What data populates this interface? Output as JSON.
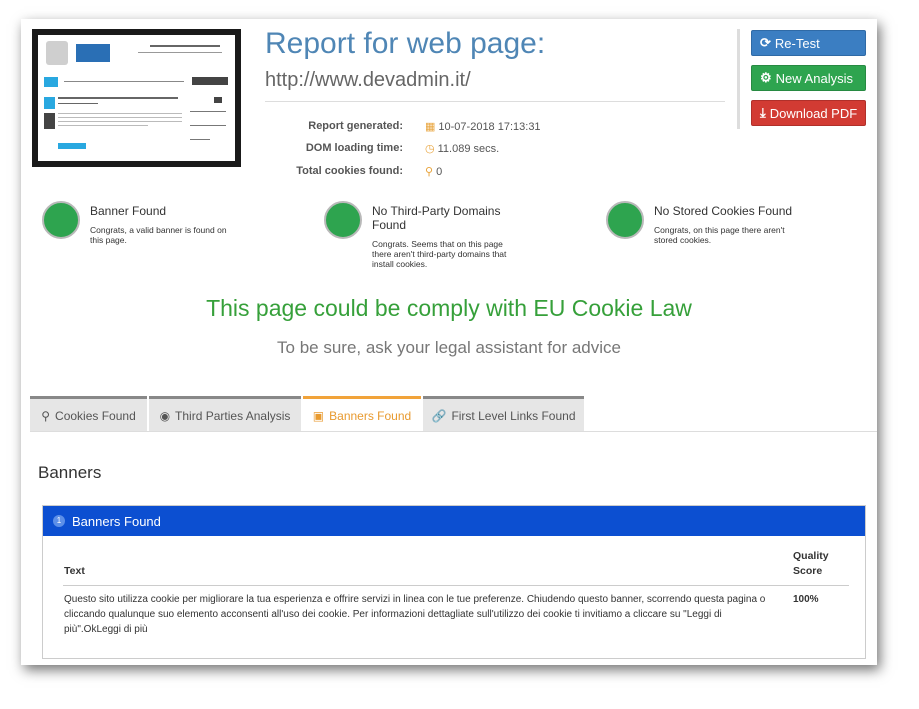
{
  "header": {
    "title": "Report for web page:",
    "url": "http://www.devadmin.it/"
  },
  "meta": {
    "generated_label": "Report generated:",
    "generated_value": "10-07-2018 17:13:31",
    "dom_label": "DOM loading time:",
    "dom_value": "11.089 secs.",
    "cookies_label": "Total cookies found:",
    "cookies_value": "0"
  },
  "buttons": {
    "retest": "Re-Test",
    "new_analysis": "New Analysis",
    "download_pdf": "Download PDF"
  },
  "status": [
    {
      "title": "Banner Found",
      "desc": "Congrats, a valid banner is found on this page."
    },
    {
      "title": "No Third-Party Domains Found",
      "desc": "Congrats. Seems that on this page there aren't third-party domains that install cookies."
    },
    {
      "title": "No Stored Cookies Found",
      "desc": "Congrats, on this page there aren't stored cookies."
    }
  ],
  "comply_text": "This page could be comply with EU Cookie Law",
  "advice_text": "To be sure, ask your legal assistant for advice",
  "tabs": [
    {
      "label": "Cookies Found",
      "icon": "search-icon"
    },
    {
      "label": "Third Parties Analysis",
      "icon": "globe-icon"
    },
    {
      "label": "Banners Found",
      "icon": "banner-icon"
    },
    {
      "label": "First Level Links Found",
      "icon": "link-icon"
    }
  ],
  "banners": {
    "heading": "Banners",
    "panel_count": "1",
    "panel_title": "Banners Found",
    "col_text": "Text",
    "col_quality_1": "Quality",
    "col_quality_2": "Score",
    "row_text": "Questo sito utilizza cookie per migliorare la tua esperienza e offrire servizi in linea con le tue preferenze. Chiudendo questo banner, scorrendo questa pagina o cliccando qualunque suo elemento acconsenti all'uso dei cookie. Per informazioni dettagliate sull'utilizzo dei cookie ti invitiamo a cliccare su \"Leggi di più\".OkLeggi di più",
    "row_score": "100%"
  },
  "colors": {
    "title": "#4f86b5",
    "comply": "#36a03a",
    "panel": "#0c4fd1",
    "active_tab": "#f1a33a"
  }
}
